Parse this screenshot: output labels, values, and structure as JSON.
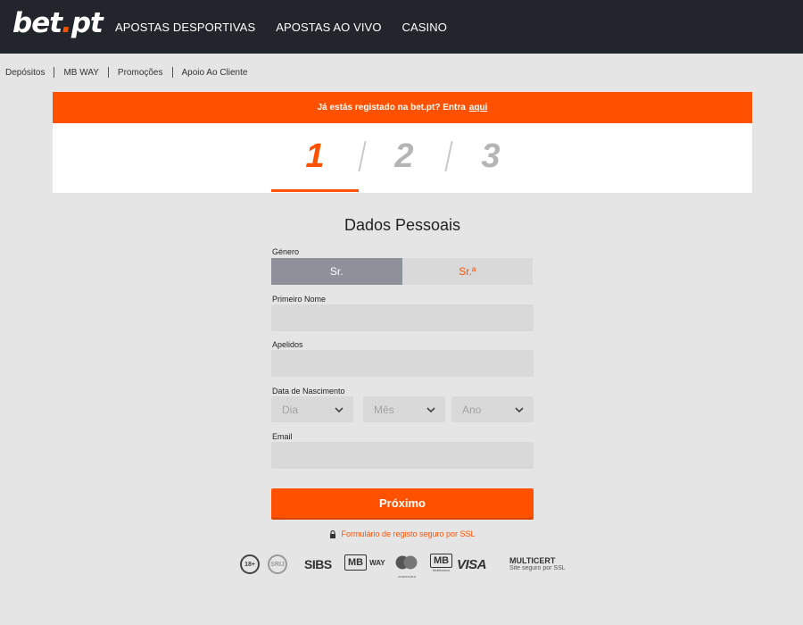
{
  "brand": {
    "logo_main": "bet",
    "logo_dot": ".",
    "logo_suffix": "pt"
  },
  "header": {
    "nav": [
      "APOSTAS DESPORTIVAS",
      "APOSTAS AO VIVO",
      "CASINO"
    ]
  },
  "subnav": [
    "Depósitos",
    "MB WAY",
    "Promoções",
    "Apoio Ao Cliente"
  ],
  "banner": {
    "text": "Já estás registado na bet.pt? Entra",
    "link": "aqui"
  },
  "steps": {
    "items": [
      "1",
      "2",
      "3"
    ],
    "active": 1
  },
  "form": {
    "title": "Dados Pessoais",
    "gender_label": "Género",
    "gender_options": [
      "Sr.",
      "Sr.ª"
    ],
    "gender_selected": "Sr.",
    "first_name_label": "Primeiro Nome",
    "first_name_value": "",
    "surname_label": "Apelidos",
    "surname_value": "",
    "dob_label": "Data de Nascimento",
    "dob_day": "Dia",
    "dob_month": "Mês",
    "dob_year": "Ano",
    "email_label": "Email",
    "email_value": "",
    "next_button": "Próximo",
    "ssl_note": "Formulário de registo seguro por SSL"
  },
  "footer": {
    "age_badge": "18+",
    "srij_badge": "SRIJ",
    "sibs": "SIBS",
    "mbway_mb": "MB",
    "mbway_way": "WAY",
    "mastercard": "mastercard",
    "multibanco": "MB",
    "multibanco_sub": "Multibanco",
    "visa": "VISA",
    "multicert_title": "MULTICERT",
    "multicert_sub": "Site seguro por SSL"
  },
  "colors": {
    "accent": "#ff5100",
    "header_bg": "#22252c",
    "page_bg": "#e5e5e5",
    "input_bg": "#d9d9d9",
    "selected_gender_bg": "#8e909a"
  }
}
